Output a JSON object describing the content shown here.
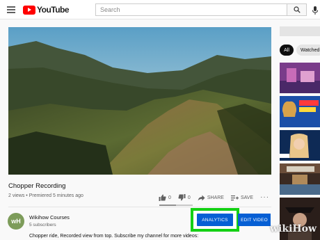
{
  "header": {
    "logo_text": "YouTube",
    "search_placeholder": "Search"
  },
  "video": {
    "title": "Chopper Recording",
    "views": "2 views",
    "separator": "•",
    "premiered": "Premiered 5 minutes ago",
    "likes": "0",
    "dislikes": "0",
    "share_label": "SHARE",
    "save_label": "SAVE",
    "more_label": "···",
    "like_ratio": 0.5
  },
  "channel": {
    "avatar_text": "wH",
    "name": "Wikihow Courses",
    "subscribers": "5 subscribers",
    "avatar_color": "#7d9c5a"
  },
  "buttons": {
    "analytics_label": "ANALYTICS",
    "edit_video_label": "EDIT VIDEO",
    "accent_color": "#065fd4",
    "highlight_color": "#14d014"
  },
  "description": "Chopper ride, Recorded view from top. Subscribe my channel for more videos:",
  "sidebar": {
    "chips": [
      "All",
      "Watched"
    ]
  },
  "watermark": {
    "part1": "wiki",
    "part2": "How"
  }
}
